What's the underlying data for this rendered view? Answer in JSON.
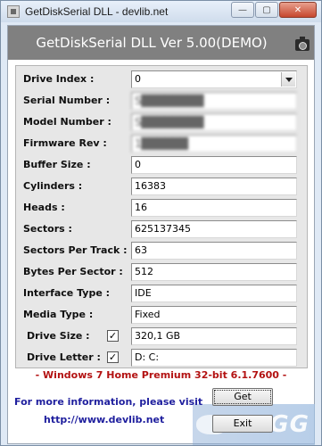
{
  "window": {
    "title": "GetDiskSerial DLL - devlib.net",
    "minimize_glyph": "—",
    "maximize_glyph": "▢",
    "close_glyph": "✕"
  },
  "header": {
    "title": "GetDiskSerial DLL Ver 5.00(DEMO)",
    "icon": "camera-icon"
  },
  "fields": {
    "drive_index": {
      "label": "Drive Index :",
      "value": "0"
    },
    "serial_number": {
      "label": "Serial Number :",
      "value": "S████████"
    },
    "model_number": {
      "label": "Model Number :",
      "value": "S████████"
    },
    "firmware_rev": {
      "label": "Firmware Rev :",
      "value": "1██████"
    },
    "buffer_size": {
      "label": "Buffer Size :",
      "value": "0"
    },
    "cylinders": {
      "label": "Cylinders :",
      "value": "16383"
    },
    "heads": {
      "label": "Heads :",
      "value": "16"
    },
    "sectors": {
      "label": "Sectors :",
      "value": "625137345"
    },
    "sectors_per_track": {
      "label": "Sectors Per Track :",
      "value": "63"
    },
    "bytes_per_sector": {
      "label": "Bytes Per Sector :",
      "value": "512"
    },
    "interface_type": {
      "label": "Interface Type :",
      "value": "IDE"
    },
    "media_type": {
      "label": "Media Type :",
      "value": "Fixed"
    },
    "drive_size": {
      "label": "Drive Size :",
      "value": "320,1 GB",
      "checked": true,
      "check_glyph": "✓"
    },
    "drive_letter": {
      "label": "Drive Letter :",
      "value": "D: C:",
      "checked": true,
      "check_glyph": "✓"
    }
  },
  "os_info": "- Windows 7 Home Premium 32-bit 6.1.7600 -",
  "footer": {
    "info_text": "For more information, please visit",
    "url": "http://www.devlib.net",
    "get_label": "Get",
    "exit_label": "Exit",
    "watermark": "ZIGG"
  }
}
